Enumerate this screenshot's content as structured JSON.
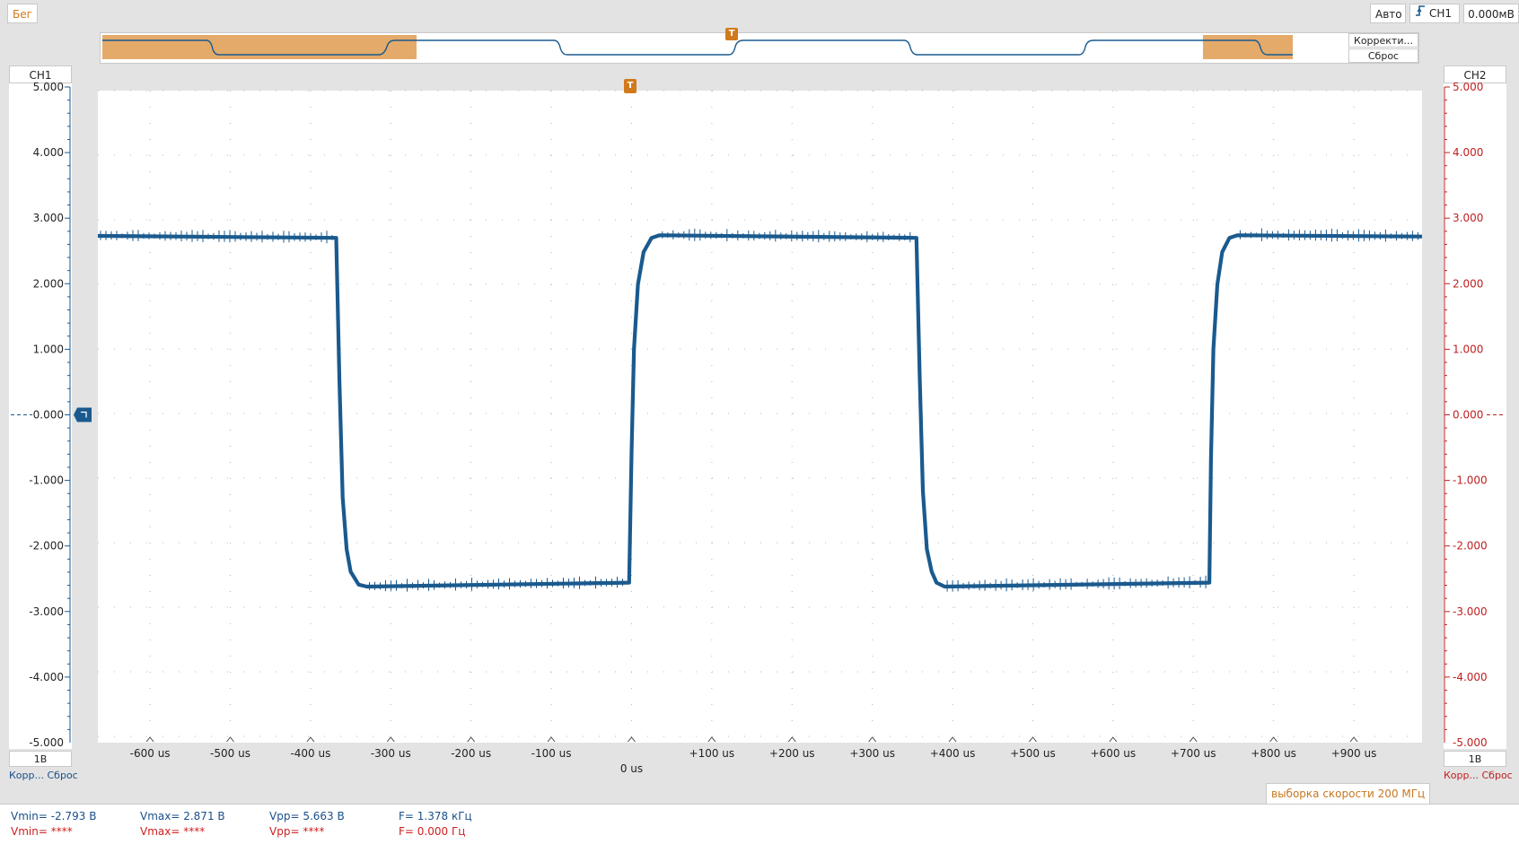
{
  "toolbar": {
    "run_label": "Бег",
    "trigger_mode": "Авто",
    "trigger_source": "CH1",
    "trigger_level": "0.000мВ"
  },
  "overview": {
    "adjust_label": "Корректи...",
    "reset_label": "Сброс",
    "trigger_marker": "T"
  },
  "ch1": {
    "name": "CH1",
    "scale": "1В",
    "adjust_label": "Корр...",
    "reset_label": "Сброс",
    "ticks": [
      "5.000",
      "4.000",
      "3.000",
      "2.000",
      "1.000",
      "0.000",
      "-1.000",
      "-2.000",
      "-3.000",
      "-4.000",
      "-5.000"
    ],
    "color": "#1a5a8e"
  },
  "ch2": {
    "name": "CH2",
    "scale": "1В",
    "adjust_label": "Корр...",
    "reset_label": "Сброс",
    "ticks": [
      "5.000",
      "4.000",
      "3.000",
      "2.000",
      "1.000",
      "0.000",
      "-1.000",
      "-2.000",
      "-3.000",
      "-4.000",
      "-5.000"
    ],
    "color": "#c02020"
  },
  "plot": {
    "trigger_marker": "T",
    "sample_rate_label": "выборка скорости 200 МГц"
  },
  "chart_data": {
    "type": "line",
    "x_unit": "us",
    "y_unit": "V",
    "xlim": [
      -665,
      985
    ],
    "ylim": [
      -5,
      5
    ],
    "x_ticks": [
      "-600 us",
      "-500 us",
      "-400 us",
      "-300 us",
      "-200 us",
      "-100 us",
      "0 us",
      "+100 us",
      "+200 us",
      "+300 us",
      "+400 us",
      "+500 us",
      "+600 us",
      "+700 us",
      "+800 us",
      "+900 us"
    ],
    "x_tick_values": [
      -600,
      -500,
      -400,
      -300,
      -200,
      -100,
      0,
      100,
      200,
      300,
      400,
      500,
      600,
      700,
      800,
      900
    ],
    "grid": true,
    "series": [
      {
        "x": [
          -665,
          -368,
          -364,
          -360,
          -355,
          -350,
          -340,
          -330,
          -3,
          0,
          3,
          8,
          15,
          25,
          35,
          355,
          359,
          363,
          368,
          374,
          380,
          390,
          720,
          722,
          725,
          730,
          736,
          745,
          755,
          985
        ],
        "y": [
          2.75,
          2.72,
          0.5,
          -1.3,
          -2.1,
          -2.45,
          -2.65,
          -2.68,
          -2.62,
          -0.6,
          1.0,
          2.0,
          2.5,
          2.72,
          2.76,
          2.72,
          0.6,
          -1.2,
          -2.1,
          -2.45,
          -2.62,
          -2.68,
          -2.62,
          -0.7,
          1.0,
          2.0,
          2.5,
          2.72,
          2.76,
          2.74
        ]
      }
    ]
  },
  "measurements": {
    "ch1": {
      "vmin": "Vmin= -2.793 В",
      "vmax": "Vmax= 2.871 В",
      "vpp": "Vpp= 5.663 В",
      "freq": "F= 1.378 кГц"
    },
    "ch2": {
      "vmin": "Vmin= ****",
      "vmax": "Vmax= ****",
      "vpp": "Vpp= ****",
      "freq": "F= 0.000 Гц"
    }
  }
}
